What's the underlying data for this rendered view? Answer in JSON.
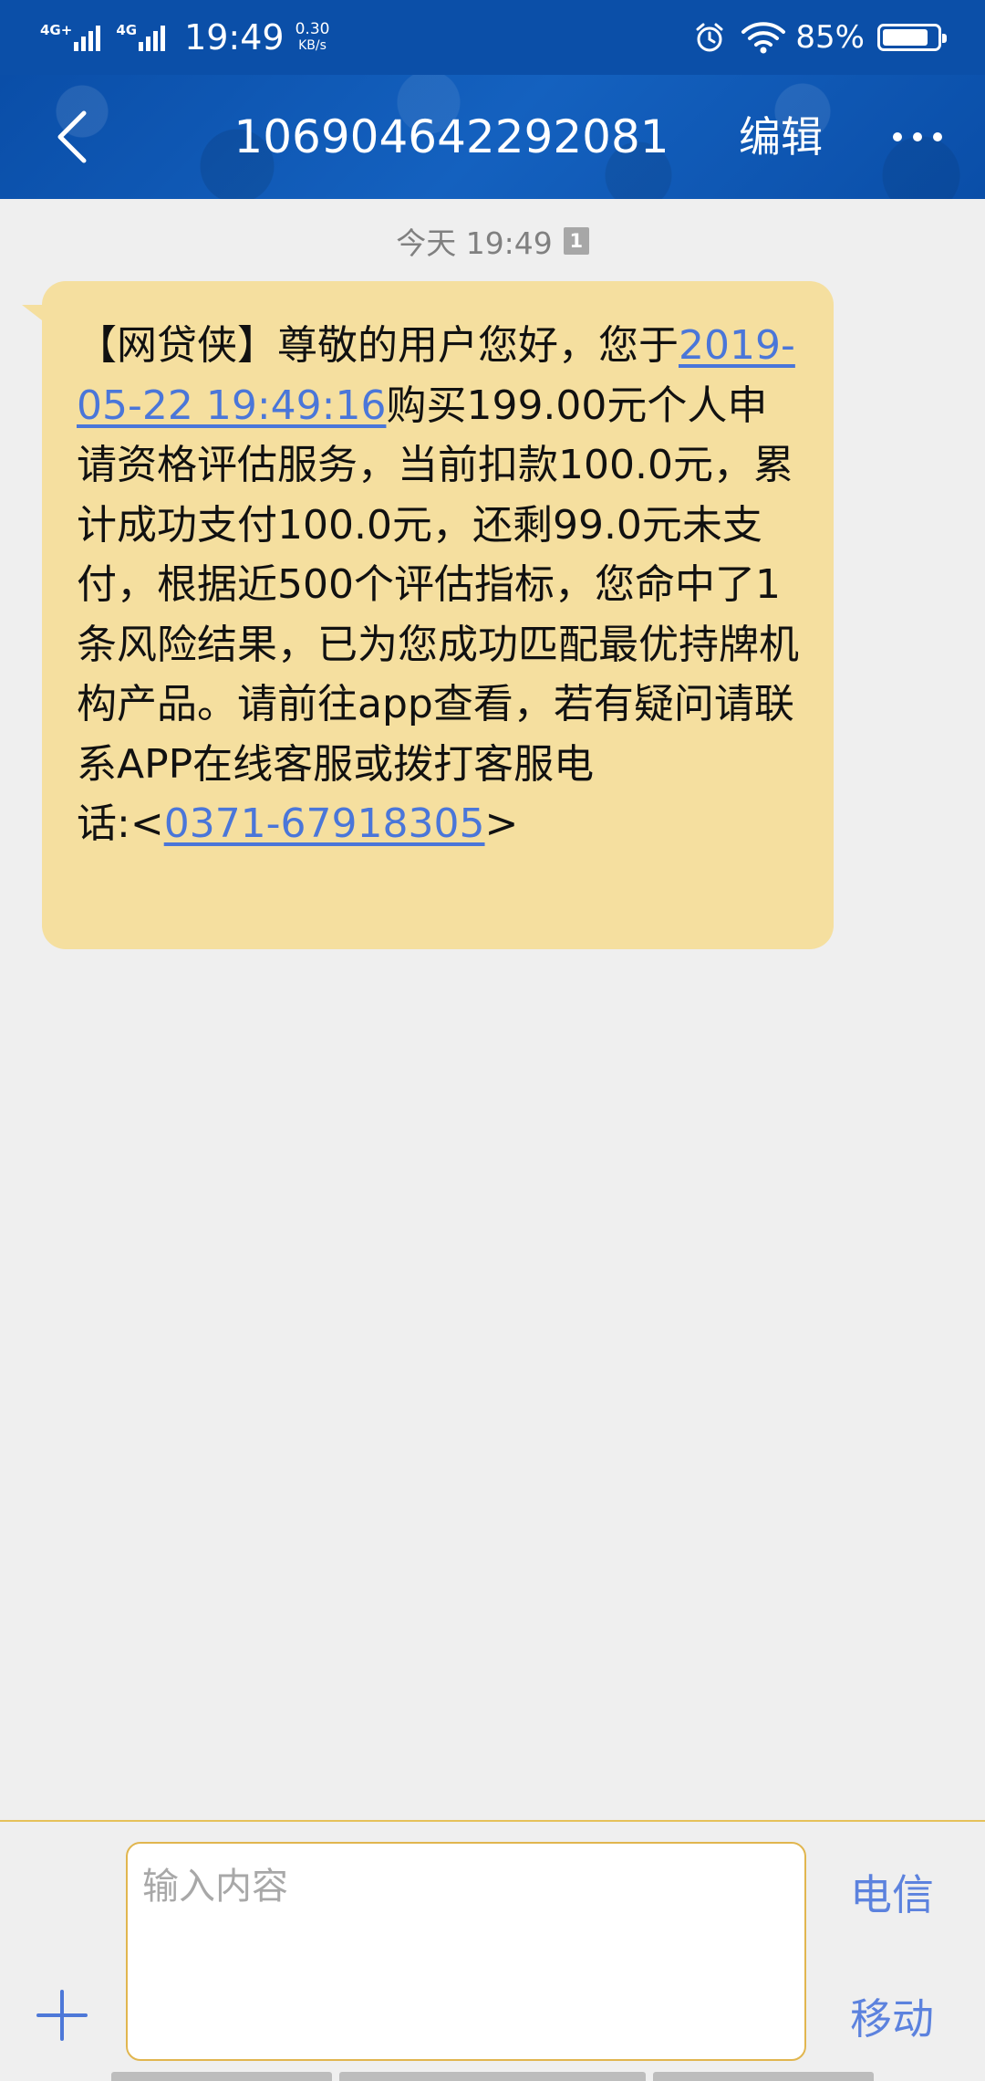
{
  "status_bar": {
    "network_1": "4G+",
    "network_2": "4G",
    "time": "19:49",
    "speed_value": "0.30",
    "speed_unit": "KB/s",
    "battery": "85%",
    "battery_level": 0.85,
    "icons": [
      "alarm-icon",
      "wifi-icon",
      "battery-icon"
    ]
  },
  "header": {
    "contact": "106904642292081",
    "edit_label": "编辑",
    "icons": [
      "back-arrow-icon",
      "more-icon"
    ]
  },
  "conversation": {
    "date_label": "今天 19:49",
    "sim_badge": "1",
    "message": {
      "seg1": "【网贷侠】尊敬的用户您好，您于",
      "date_link": "2019-05-22 19:49:16",
      "seg2": "购买199.00元个人申请资格评估服务，当前扣款100.0元，累计成功支付100.0元，还剩99.0元未支付，根据近500个评估指标，您命中了1条风险结果，已为您成功匹配最优持牌机构产品。请前往app查看，若有疑问请联系APP在线客服或拨打客服电",
      "seg3": "话:<",
      "phone_link": "0371-67918305",
      "seg4": ">"
    }
  },
  "composer": {
    "placeholder": "输入内容",
    "send_telecom": "电信",
    "send_mobile": "移动",
    "icons": [
      "plus-icon"
    ]
  },
  "colors": {
    "header_blue": "#0c55b2",
    "bubble": "#f5df9f",
    "link": "#4a76d9",
    "send_button": "#5c82de",
    "input_border": "#e1b64f"
  }
}
